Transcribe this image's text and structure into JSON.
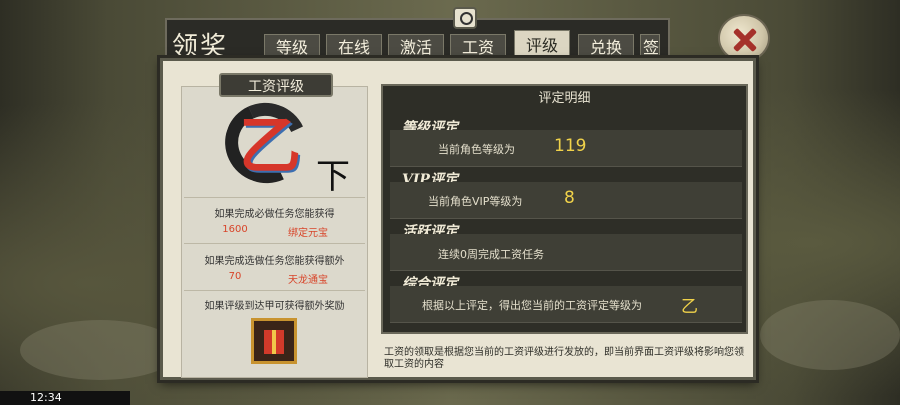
{
  "window": {
    "title": "领奖"
  },
  "tabs": [
    {
      "label": "等级"
    },
    {
      "label": "在线"
    },
    {
      "label": "激活"
    },
    {
      "label": "工资"
    },
    {
      "label": "评级",
      "active": true
    },
    {
      "label": "兑换"
    },
    {
      "label": "签"
    }
  ],
  "left_card": {
    "title": "工资评级",
    "grade": "乙",
    "grade_sub": "下",
    "line1": "如果完成必做任务您能获得",
    "reward1_value": "1600",
    "reward1_type": "绑定元宝",
    "line2": "如果完成选做任务您能获得额外",
    "reward2_value": "70",
    "reward2_type": "天龙通宝",
    "line3": "如果评级到达甲可获得额外奖励",
    "gift_icon": "gift-box-icon"
  },
  "details": {
    "title": "评定明细",
    "sections": [
      {
        "label": "等级评定",
        "text": "当前角色等级为",
        "value": "119"
      },
      {
        "label": "VIP评定",
        "text": "当前角色VIP等级为",
        "value": "8"
      },
      {
        "label": "活跃评定",
        "text": "连续0周完成工资任务",
        "value": ""
      },
      {
        "label": "综合评定",
        "text": "根据以上评定，得出您当前的工资评定等级为",
        "value": "乙"
      }
    ]
  },
  "note": "工资的领取是根据您当前的工资评级进行发放的，即当前界面工资评级将影响您领取工资的内容",
  "status_bar": {
    "time": "12:34"
  },
  "colors": {
    "accent_yellow": "#f0d24a",
    "reward_red": "#d8452a",
    "panel_dark": "#2e2e27"
  }
}
